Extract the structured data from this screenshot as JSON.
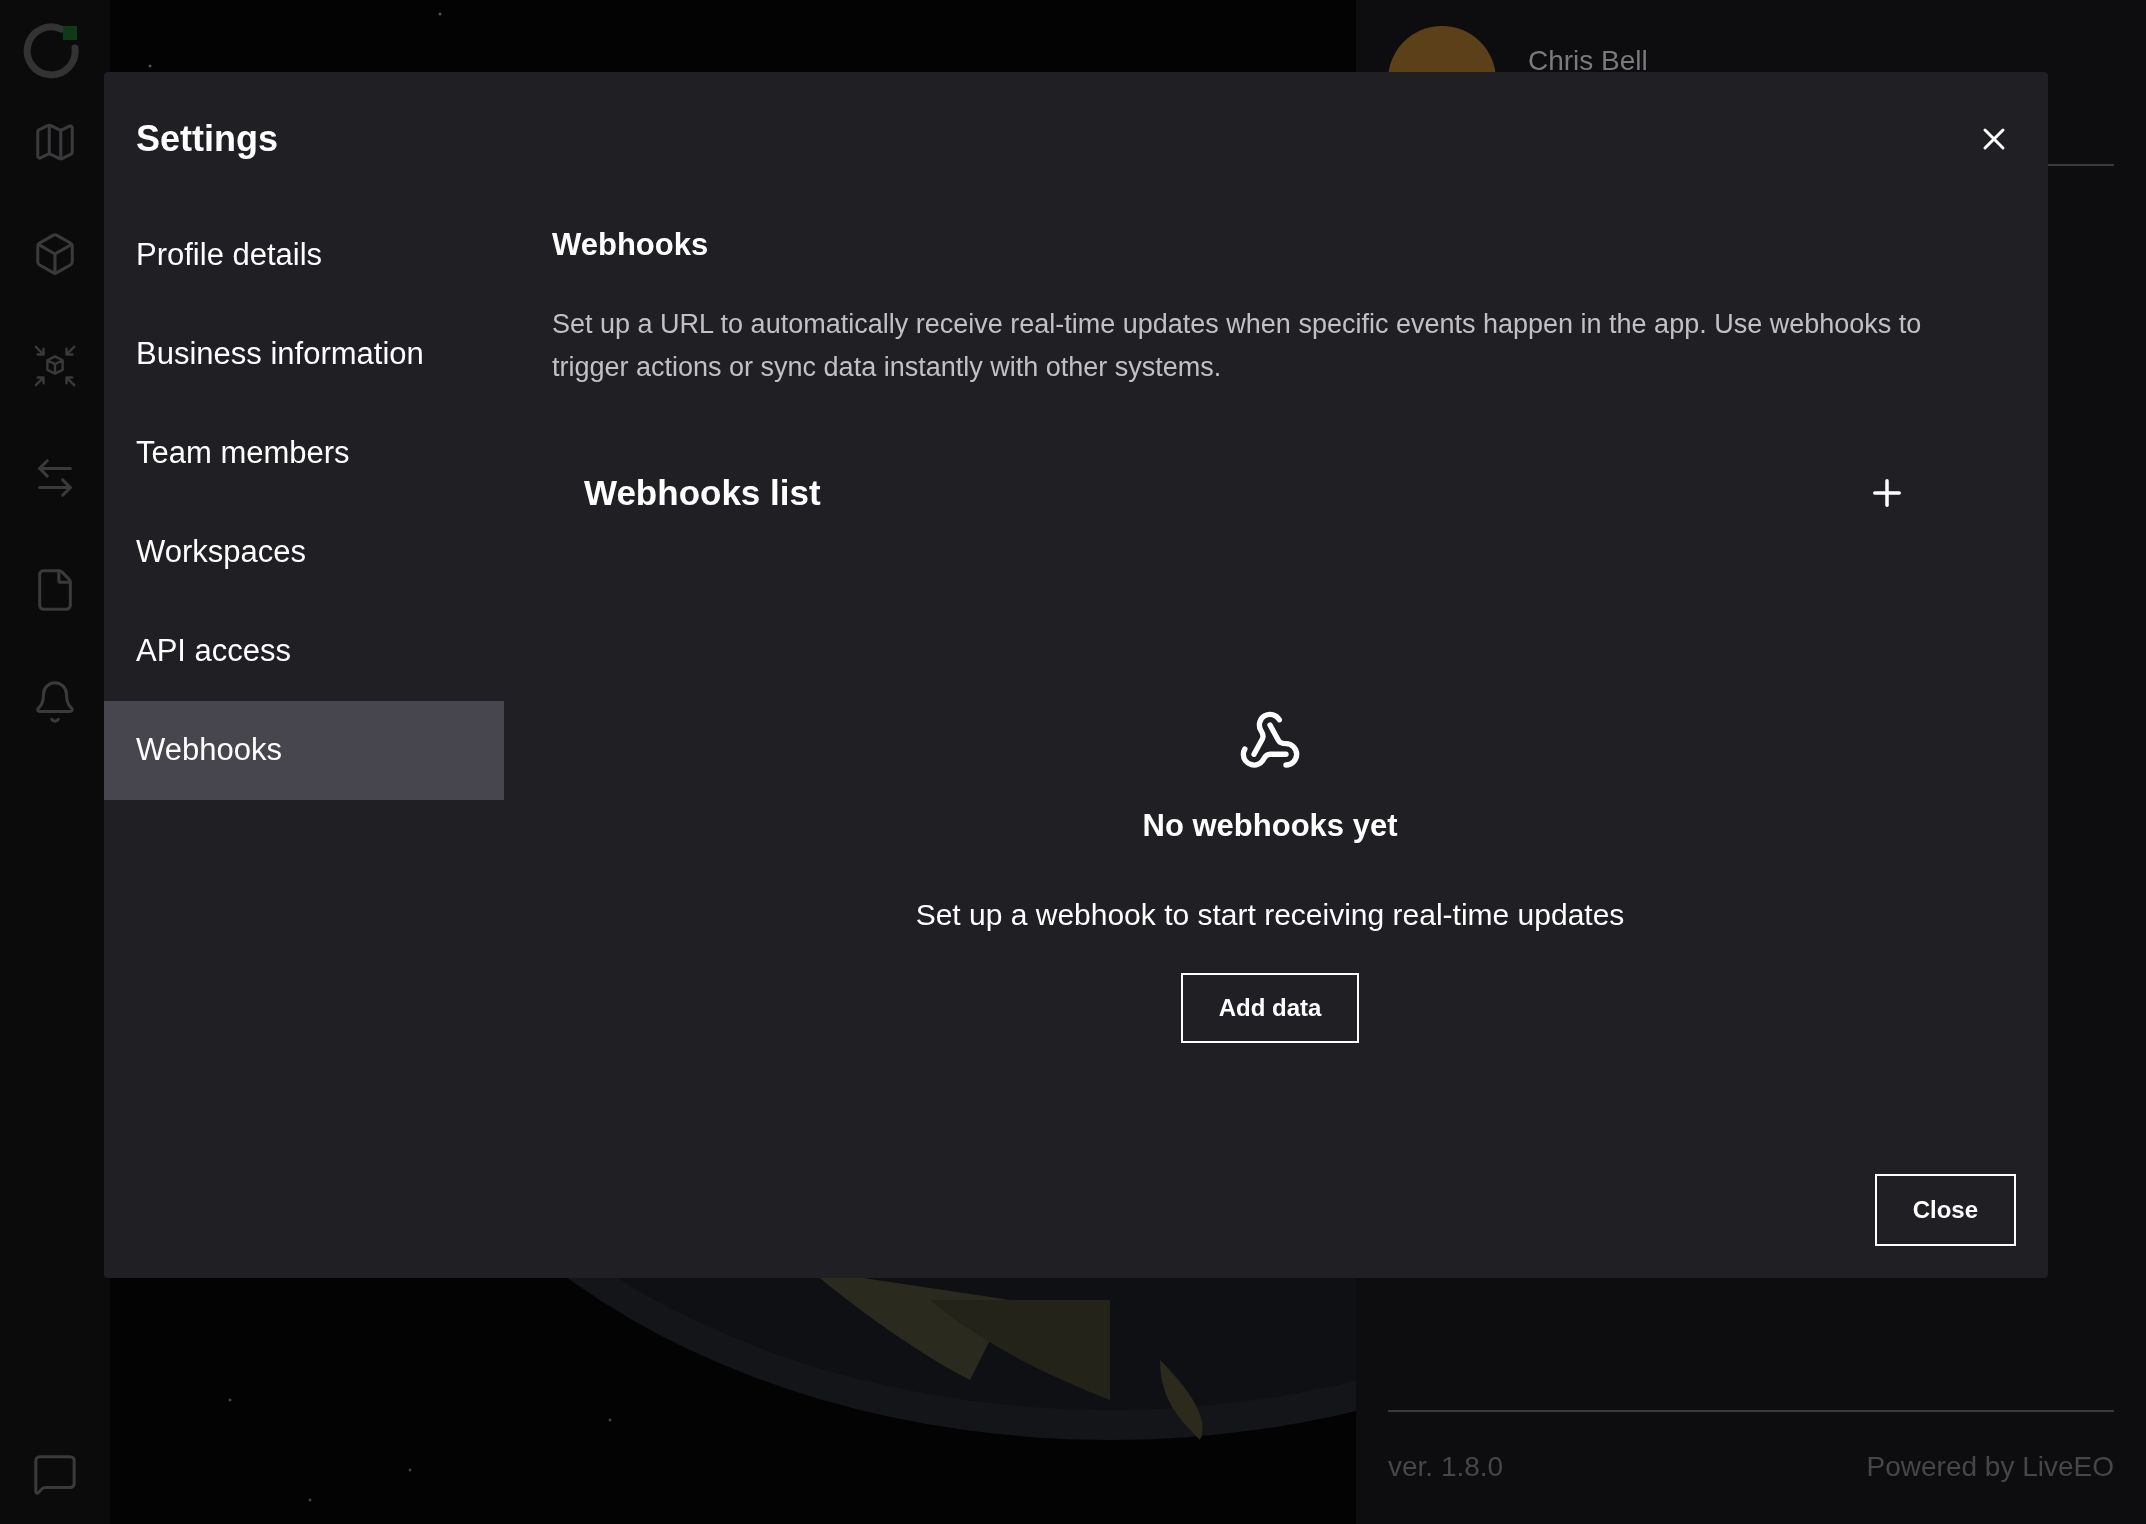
{
  "rail": {
    "items": [
      {
        "kind": "map"
      },
      {
        "kind": "box"
      },
      {
        "kind": "collapse"
      },
      {
        "kind": "transfer"
      },
      {
        "kind": "file"
      },
      {
        "kind": "bell"
      }
    ],
    "help": {
      "kind": "help"
    }
  },
  "profile_panel": {
    "name": "Chris Bell",
    "version": "ver. 1.8.0",
    "powered_by": "Powered by LiveEO"
  },
  "dialog": {
    "title": "Settings",
    "nav": [
      {
        "label": "Profile details",
        "selected": false
      },
      {
        "label": "Business information",
        "selected": false
      },
      {
        "label": "Team members",
        "selected": false
      },
      {
        "label": "Workspaces",
        "selected": false
      },
      {
        "label": "API access",
        "selected": false
      },
      {
        "label": "Webhooks",
        "selected": true
      }
    ],
    "section": {
      "title": "Webhooks",
      "description": "Set up a URL to automatically receive real-time updates when specific events happen in the app. Use webhooks to trigger actions or sync data instantly with other systems.",
      "list_title": "Webhooks list",
      "empty": {
        "title": "No webhooks yet",
        "text": "Set up a webhook to start receiving real-time updates",
        "button": "Add data"
      }
    },
    "footer_button": "Close"
  }
}
